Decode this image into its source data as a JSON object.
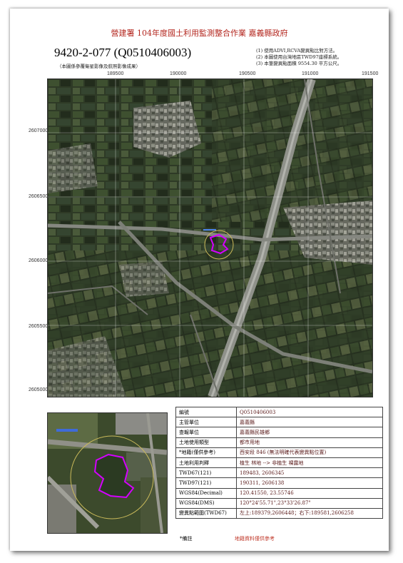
{
  "header": {
    "title": "營建署 104年度國土利用監測整合作業 嘉義縣政府",
    "code": "9420-2-077 (Q0510406003)",
    "code_note": "（本圖係參覆衛星影像及航照影像成果）",
    "notes": [
      "(1) 使用ADVI,RCVA變異點比對方法。",
      "(2) 本圖使用台灣地區TWD97座標系統。",
      "(3) 本筆變異點面積 9554.30 平方公尺。"
    ]
  },
  "map": {
    "x_ticks": [
      "189500",
      "190000",
      "190500",
      "191000",
      "191500"
    ],
    "y_ticks": [
      "2607000",
      "2606500",
      "2606000",
      "2605500",
      "2605000"
    ],
    "colors": {
      "boundary": "#d400ff",
      "field": "#2a3a22",
      "road": "#8a8d86"
    }
  },
  "info_table": [
    {
      "key": "編號",
      "value": "Q0510406003"
    },
    {
      "key": "主管單位",
      "value": "嘉義縣"
    },
    {
      "key": "查報單位",
      "value": "嘉義縣民雄鄉"
    },
    {
      "key": "土地使用類型",
      "value": "都市用地"
    },
    {
      "key": "*地籍(僅供參考)",
      "value": "西安段 846 (無法明確代表變異點位置)"
    },
    {
      "key": "土地利用判釋",
      "value": "植生 林地 --> 非植生 裸露地"
    },
    {
      "key": "TWD67(121)",
      "value": "189483, 2606345"
    },
    {
      "key": "TWD97(121)",
      "value": "190311, 2606138"
    },
    {
      "key": "WGS84(Decimal)",
      "value": "120.41550, 23.55746"
    },
    {
      "key": "WGS84(DMS)",
      "value": "120°24'55.71\",23°33'26.87\""
    },
    {
      "key": "變異點範圍(TWD67)",
      "value": "左上:189379,2606448；右下:189581,2606258"
    }
  ],
  "footer": {
    "label": "*備註",
    "value": "地籍資料僅供參考"
  }
}
